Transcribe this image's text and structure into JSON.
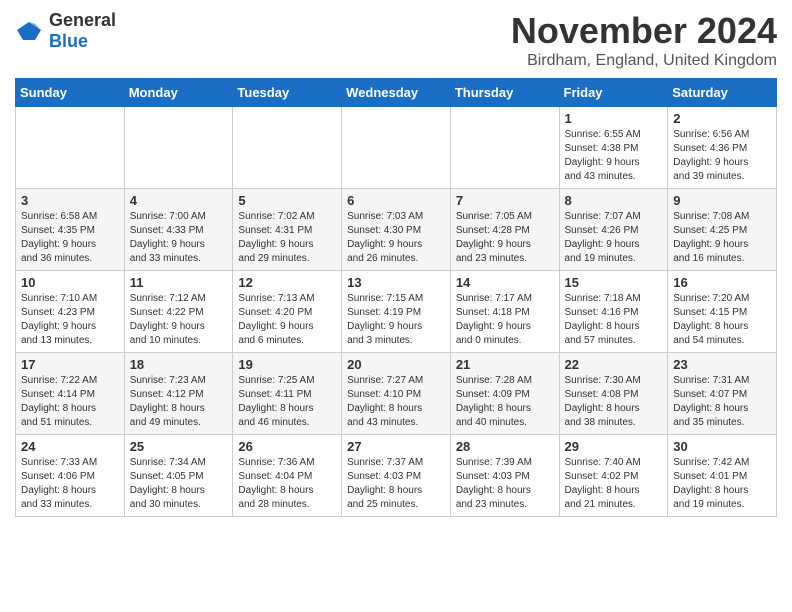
{
  "header": {
    "logo_general": "General",
    "logo_blue": "Blue",
    "month_title": "November 2024",
    "location": "Birdham, England, United Kingdom"
  },
  "weekdays": [
    "Sunday",
    "Monday",
    "Tuesday",
    "Wednesday",
    "Thursday",
    "Friday",
    "Saturday"
  ],
  "weeks": [
    [
      {
        "day": "",
        "info": ""
      },
      {
        "day": "",
        "info": ""
      },
      {
        "day": "",
        "info": ""
      },
      {
        "day": "",
        "info": ""
      },
      {
        "day": "",
        "info": ""
      },
      {
        "day": "1",
        "info": "Sunrise: 6:55 AM\nSunset: 4:38 PM\nDaylight: 9 hours\nand 43 minutes."
      },
      {
        "day": "2",
        "info": "Sunrise: 6:56 AM\nSunset: 4:36 PM\nDaylight: 9 hours\nand 39 minutes."
      }
    ],
    [
      {
        "day": "3",
        "info": "Sunrise: 6:58 AM\nSunset: 4:35 PM\nDaylight: 9 hours\nand 36 minutes."
      },
      {
        "day": "4",
        "info": "Sunrise: 7:00 AM\nSunset: 4:33 PM\nDaylight: 9 hours\nand 33 minutes."
      },
      {
        "day": "5",
        "info": "Sunrise: 7:02 AM\nSunset: 4:31 PM\nDaylight: 9 hours\nand 29 minutes."
      },
      {
        "day": "6",
        "info": "Sunrise: 7:03 AM\nSunset: 4:30 PM\nDaylight: 9 hours\nand 26 minutes."
      },
      {
        "day": "7",
        "info": "Sunrise: 7:05 AM\nSunset: 4:28 PM\nDaylight: 9 hours\nand 23 minutes."
      },
      {
        "day": "8",
        "info": "Sunrise: 7:07 AM\nSunset: 4:26 PM\nDaylight: 9 hours\nand 19 minutes."
      },
      {
        "day": "9",
        "info": "Sunrise: 7:08 AM\nSunset: 4:25 PM\nDaylight: 9 hours\nand 16 minutes."
      }
    ],
    [
      {
        "day": "10",
        "info": "Sunrise: 7:10 AM\nSunset: 4:23 PM\nDaylight: 9 hours\nand 13 minutes."
      },
      {
        "day": "11",
        "info": "Sunrise: 7:12 AM\nSunset: 4:22 PM\nDaylight: 9 hours\nand 10 minutes."
      },
      {
        "day": "12",
        "info": "Sunrise: 7:13 AM\nSunset: 4:20 PM\nDaylight: 9 hours\nand 6 minutes."
      },
      {
        "day": "13",
        "info": "Sunrise: 7:15 AM\nSunset: 4:19 PM\nDaylight: 9 hours\nand 3 minutes."
      },
      {
        "day": "14",
        "info": "Sunrise: 7:17 AM\nSunset: 4:18 PM\nDaylight: 9 hours\nand 0 minutes."
      },
      {
        "day": "15",
        "info": "Sunrise: 7:18 AM\nSunset: 4:16 PM\nDaylight: 8 hours\nand 57 minutes."
      },
      {
        "day": "16",
        "info": "Sunrise: 7:20 AM\nSunset: 4:15 PM\nDaylight: 8 hours\nand 54 minutes."
      }
    ],
    [
      {
        "day": "17",
        "info": "Sunrise: 7:22 AM\nSunset: 4:14 PM\nDaylight: 8 hours\nand 51 minutes."
      },
      {
        "day": "18",
        "info": "Sunrise: 7:23 AM\nSunset: 4:12 PM\nDaylight: 8 hours\nand 49 minutes."
      },
      {
        "day": "19",
        "info": "Sunrise: 7:25 AM\nSunset: 4:11 PM\nDaylight: 8 hours\nand 46 minutes."
      },
      {
        "day": "20",
        "info": "Sunrise: 7:27 AM\nSunset: 4:10 PM\nDaylight: 8 hours\nand 43 minutes."
      },
      {
        "day": "21",
        "info": "Sunrise: 7:28 AM\nSunset: 4:09 PM\nDaylight: 8 hours\nand 40 minutes."
      },
      {
        "day": "22",
        "info": "Sunrise: 7:30 AM\nSunset: 4:08 PM\nDaylight: 8 hours\nand 38 minutes."
      },
      {
        "day": "23",
        "info": "Sunrise: 7:31 AM\nSunset: 4:07 PM\nDaylight: 8 hours\nand 35 minutes."
      }
    ],
    [
      {
        "day": "24",
        "info": "Sunrise: 7:33 AM\nSunset: 4:06 PM\nDaylight: 8 hours\nand 33 minutes."
      },
      {
        "day": "25",
        "info": "Sunrise: 7:34 AM\nSunset: 4:05 PM\nDaylight: 8 hours\nand 30 minutes."
      },
      {
        "day": "26",
        "info": "Sunrise: 7:36 AM\nSunset: 4:04 PM\nDaylight: 8 hours\nand 28 minutes."
      },
      {
        "day": "27",
        "info": "Sunrise: 7:37 AM\nSunset: 4:03 PM\nDaylight: 8 hours\nand 25 minutes."
      },
      {
        "day": "28",
        "info": "Sunrise: 7:39 AM\nSunset: 4:03 PM\nDaylight: 8 hours\nand 23 minutes."
      },
      {
        "day": "29",
        "info": "Sunrise: 7:40 AM\nSunset: 4:02 PM\nDaylight: 8 hours\nand 21 minutes."
      },
      {
        "day": "30",
        "info": "Sunrise: 7:42 AM\nSunset: 4:01 PM\nDaylight: 8 hours\nand 19 minutes."
      }
    ]
  ]
}
